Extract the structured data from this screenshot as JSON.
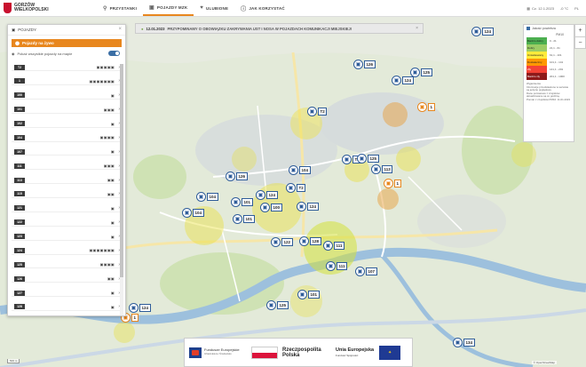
{
  "brand": {
    "line1": "GORZÓW",
    "line2": "WIELKOPOLSKI"
  },
  "nav": [
    {
      "label": "PRZYSTANKI",
      "icon": "bus-stop-icon"
    },
    {
      "label": "POJAZDY MZK",
      "icon": "bus-icon"
    },
    {
      "label": "ULUBIONE",
      "icon": "heart-icon"
    },
    {
      "label": "JAK KORZYSTAĆ",
      "icon": "info-icon"
    }
  ],
  "header_right": {
    "datetime": "Cz. 12.1.2023",
    "temp": "-0 °C",
    "lang": "PL"
  },
  "panel": {
    "title": "POJAZDY",
    "live_label": "Pojazdy na żywo",
    "toggle_label": "Pokaż wszystkie pojazdy na mapie"
  },
  "routes": [
    {
      "id": "T2",
      "icons": "▣▣▣▣▣"
    },
    {
      "id": "1",
      "icons": "▣▣▣▣▣▣▣"
    },
    {
      "id": "100",
      "icons": "▣"
    },
    {
      "id": "101",
      "icons": "▣▣▣"
    },
    {
      "id": "102",
      "icons": "▣"
    },
    {
      "id": "104",
      "icons": "▣▣▣▣"
    },
    {
      "id": "107",
      "icons": "▣"
    },
    {
      "id": "111",
      "icons": "▣▣▣"
    },
    {
      "id": "113",
      "icons": "▣▣"
    },
    {
      "id": "115",
      "icons": "▣▣"
    },
    {
      "id": "121",
      "icons": "▣"
    },
    {
      "id": "122",
      "icons": "▣"
    },
    {
      "id": "123",
      "icons": "▣"
    },
    {
      "id": "124",
      "icons": "▣▣▣▣▣▣▣"
    },
    {
      "id": "125",
      "icons": "▣▣▣▣"
    },
    {
      "id": "126",
      "icons": "▣▣"
    },
    {
      "id": "127",
      "icons": "▣"
    },
    {
      "id": "128",
      "icons": "▣"
    },
    {
      "id": "129",
      "icons": "▣"
    }
  ],
  "notice": {
    "date": "12.01.2023",
    "text": "PRZYPOMINAMY O OBOWIĄZKU ZAKRYWANIA UST I NOSA W POJAZDACH KOMUNIKACJI MIEJSKIEJ!"
  },
  "legend": {
    "title": "Jakość powietrza",
    "pollutant": "PM10",
    "rows": [
      {
        "label": "Bardzo dobry",
        "range": "0 - 21",
        "color": "#4caf50"
      },
      {
        "label": "Dobry",
        "range": "21,1 - 61",
        "color": "#9ccc65"
      },
      {
        "label": "Umiarkowany",
        "range": "61,1 - 101",
        "color": "#ffeb3b"
      },
      {
        "label": "Dostateczny",
        "range": "101,1 - 141",
        "color": "#ff9800"
      },
      {
        "label": "Zły",
        "range": "141,1 - 201",
        "color": "#f44336"
      },
      {
        "label": "Bardzo zły",
        "range": "201,1 - 1000",
        "color": "#8e1a1a"
      }
    ],
    "note_title": "Wyjaśnienia:",
    "note1": "Informacje przedstawione w serwisie są jedynie poglądowe.",
    "note2": "Dane pomiarowe z czujników aktualizowane są co godzinę.",
    "note3": "Pomiar z czujników PM10: 11.01.2023"
  },
  "zoom": {
    "in": "+",
    "out": "−"
  },
  "footer": {
    "fe_title": "Fundusze Europejskie",
    "fe_sub": "Infrastruktura i Środowisko",
    "rp": "Rzeczpospolita Polska",
    "ue": "Unia Europejska",
    "ue_sub": "Fundusz Spójności"
  },
  "map_copyright": "© OpenStreetMap",
  "scale": "500 m",
  "vehicles": [
    {
      "num": "124",
      "type": "bus"
    },
    {
      "num": "126",
      "type": "bus"
    },
    {
      "num": "125",
      "type": "bus"
    },
    {
      "num": "124",
      "type": "bus"
    },
    {
      "num": "1",
      "type": "tram"
    },
    {
      "num": "T2",
      "type": "bus"
    },
    {
      "num": "T2",
      "type": "bus"
    },
    {
      "num": "104",
      "type": "bus"
    },
    {
      "num": "126",
      "type": "bus"
    },
    {
      "num": "T2",
      "type": "bus"
    },
    {
      "num": "124",
      "type": "bus"
    },
    {
      "num": "104",
      "type": "bus"
    },
    {
      "num": "101",
      "type": "bus"
    },
    {
      "num": "100",
      "type": "bus"
    },
    {
      "num": "124",
      "type": "bus"
    },
    {
      "num": "104",
      "type": "bus"
    },
    {
      "num": "101",
      "type": "bus"
    },
    {
      "num": "125",
      "type": "bus"
    },
    {
      "num": "113",
      "type": "bus"
    },
    {
      "num": "1",
      "type": "tram"
    },
    {
      "num": "122",
      "type": "bus"
    },
    {
      "num": "128",
      "type": "bus"
    },
    {
      "num": "111",
      "type": "bus"
    },
    {
      "num": "111",
      "type": "bus"
    },
    {
      "num": "107",
      "type": "bus"
    },
    {
      "num": "101",
      "type": "bus"
    },
    {
      "num": "125",
      "type": "bus"
    },
    {
      "num": "124",
      "type": "bus"
    },
    {
      "num": "1",
      "type": "tram"
    },
    {
      "num": "134",
      "type": "bus"
    }
  ]
}
